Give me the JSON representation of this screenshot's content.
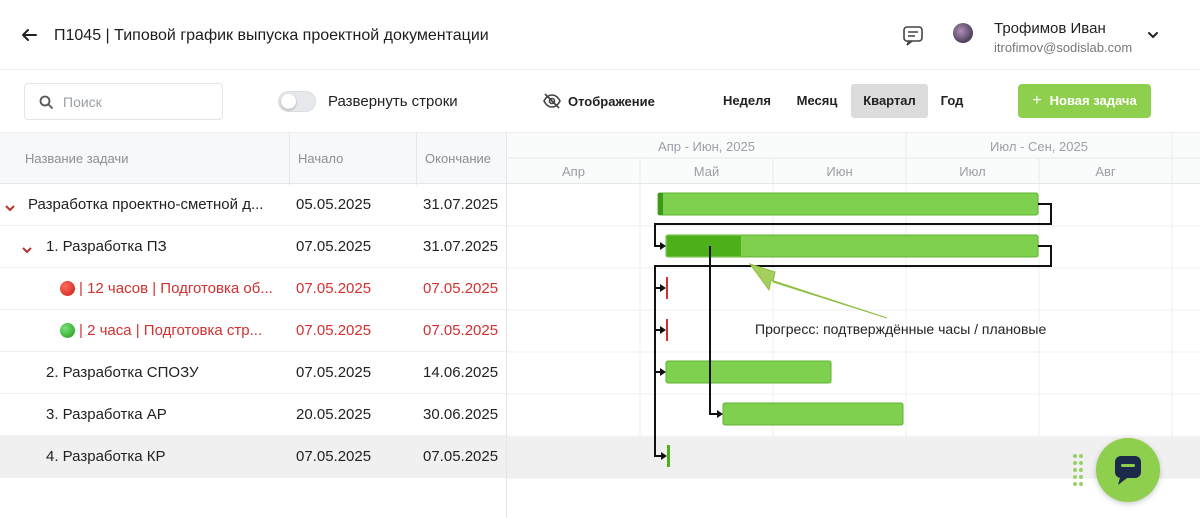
{
  "header": {
    "title": "П1045 | Типовой график выпуска проектной документации",
    "user_name": "Трофимов Иван",
    "user_email": "itrofimov@sodislab.com"
  },
  "toolbar": {
    "search_placeholder": "Поиск",
    "expand_rows_label": "Развернуть строки",
    "expand_rows_on": false,
    "display_label": "Отображение",
    "scale_buttons": [
      "Неделя",
      "Месяц",
      "Квартал",
      "Год"
    ],
    "active_scale": "Квартал",
    "new_task_label": "Новая задача"
  },
  "grid": {
    "columns": [
      "Название задачи",
      "Начало",
      "Окончание"
    ],
    "rows": [
      {
        "name": "Разработка проектно-сметной д...",
        "start": "05.05.2025",
        "end": "31.07.2025",
        "level": 0,
        "expandable": true
      },
      {
        "name": "1. Разработка ПЗ",
        "start": "07.05.2025",
        "end": "31.07.2025",
        "level": 1,
        "expandable": true
      },
      {
        "name": "| 12 часов | Подготовка об...",
        "start": "07.05.2025",
        "end": "07.05.2025",
        "level": 2,
        "status": "red"
      },
      {
        "name": "| 2 часа | Подготовка стр...",
        "start": "07.05.2025",
        "end": "07.05.2025",
        "level": 2,
        "status": "green"
      },
      {
        "name": "2. Разработка СПОЗУ",
        "start": "07.05.2025",
        "end": "14.06.2025",
        "level": 1
      },
      {
        "name": "3. Разработка АР",
        "start": "20.05.2025",
        "end": "30.06.2025",
        "level": 1
      },
      {
        "name": "4. Разработка КР",
        "start": "07.05.2025",
        "end": "07.05.2025",
        "level": 1,
        "selected": true
      }
    ]
  },
  "gantt": {
    "quarters": [
      "Апр - Июн, 2025",
      "Июл - Сен, 2025"
    ],
    "months": [
      "Апр",
      "Май",
      "Июн",
      "Июл",
      "Авг"
    ],
    "bar_color": "#7fd04f",
    "progress_color": "#4db01a",
    "annotation": "Прогресс: подтверждённые часы / плановые"
  },
  "colors": {
    "accent": "#8ecf4d",
    "danger": "#d3302f"
  }
}
